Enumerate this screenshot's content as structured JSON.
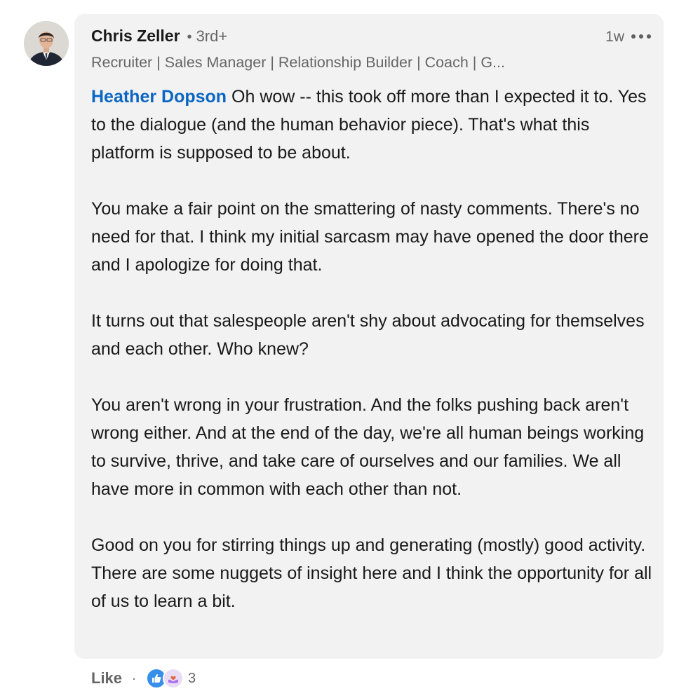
{
  "colors": {
    "bubble_bg": "#f2f2f2",
    "mention": "#0a66c2",
    "secondary_text": "#666666",
    "primary_text": "#191919",
    "like_reaction": "#378fe9",
    "support_reaction": "#a872e8"
  },
  "comment": {
    "author": {
      "name": "Chris Zeller",
      "separator": "•",
      "degree": "3rd+",
      "headline": "Recruiter | Sales Manager | Relationship Builder | Coach | G...",
      "avatar_icon": "profile-photo"
    },
    "timestamp": "1w",
    "more_icon": "ellipsis-icon",
    "mention": "Heather Dopson",
    "paragraphs": [
      " Oh wow -- this took off more than I expected it to. Yes to the dialogue (and the human behavior piece). That's what this platform is supposed to be about.",
      "You make a fair point on the smattering of nasty comments. There's no need for that. I think my initial sarcasm may have opened the door there and I apologize for doing that.",
      "It turns out that salespeople aren't shy about advocating for themselves and each other. Who knew?",
      "You aren't wrong in your frustration. And the folks pushing back aren't wrong either. And at the end of the day, we're all human beings working to survive, thrive, and take care of ourselves and our families. We all have more in common with each other than not.",
      "Good on you for stirring things up and generating (mostly) good activity. There are some nuggets of insight here and I think the opportunity for all of us to learn a bit."
    ]
  },
  "actions": {
    "like_label": "Like",
    "separator": "·",
    "reaction_icons": [
      "like-icon",
      "support-icon"
    ],
    "reaction_count": "3"
  }
}
